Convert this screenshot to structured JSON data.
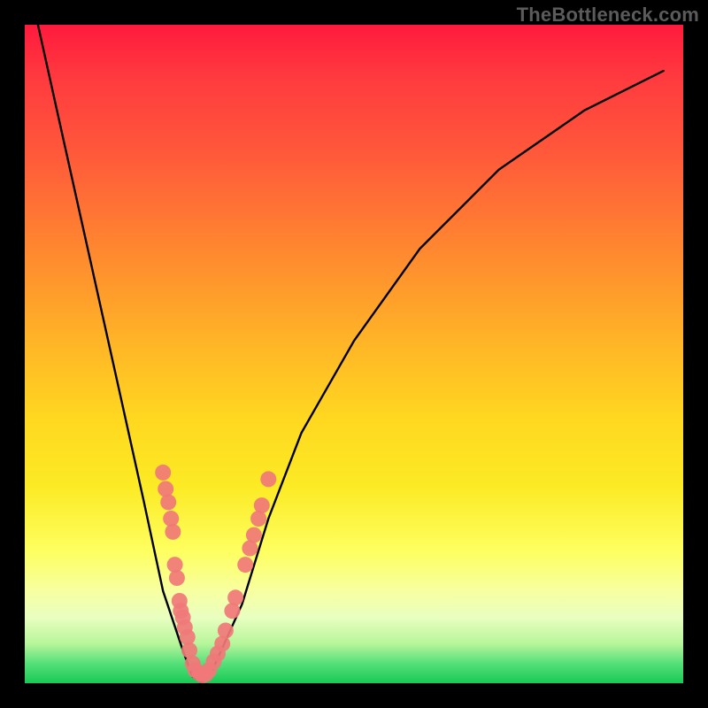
{
  "watermark": "TheBottleneck.com",
  "chart_data": {
    "type": "line",
    "title": "",
    "xlabel": "",
    "ylabel": "",
    "xlim": [
      0,
      100
    ],
    "ylim": [
      0,
      100
    ],
    "grid": false,
    "legend": false,
    "series": [
      {
        "name": "curve",
        "x": [
          2,
          6,
          10,
          14,
          18,
          21,
          24,
          25.5,
          27,
          28.5,
          33,
          37,
          42,
          50,
          60,
          72,
          85,
          97
        ],
        "values": [
          100,
          82,
          64,
          46,
          28,
          14,
          5,
          1,
          0,
          2,
          12,
          25,
          38,
          52,
          66,
          78,
          87,
          93
        ]
      }
    ],
    "markers": [
      {
        "x": 21.0,
        "y": 32.0
      },
      {
        "x": 21.4,
        "y": 29.5
      },
      {
        "x": 21.8,
        "y": 27.5
      },
      {
        "x": 22.2,
        "y": 25.0
      },
      {
        "x": 22.5,
        "y": 23.0
      },
      {
        "x": 22.8,
        "y": 18.0
      },
      {
        "x": 23.1,
        "y": 16.0
      },
      {
        "x": 23.5,
        "y": 12.5
      },
      {
        "x": 23.7,
        "y": 11.0
      },
      {
        "x": 24.0,
        "y": 10.0
      },
      {
        "x": 24.3,
        "y": 8.5
      },
      {
        "x": 24.7,
        "y": 7.0
      },
      {
        "x": 25.0,
        "y": 5.0
      },
      {
        "x": 25.5,
        "y": 3.0
      },
      {
        "x": 25.9,
        "y": 2.0
      },
      {
        "x": 26.5,
        "y": 1.5
      },
      {
        "x": 27.0,
        "y": 1.2
      },
      {
        "x": 27.5,
        "y": 1.4
      },
      {
        "x": 28.0,
        "y": 2.0
      },
      {
        "x": 28.7,
        "y": 3.3
      },
      {
        "x": 29.3,
        "y": 4.5
      },
      {
        "x": 30.0,
        "y": 6.0
      },
      {
        "x": 30.5,
        "y": 8.0
      },
      {
        "x": 31.5,
        "y": 11.0
      },
      {
        "x": 32.0,
        "y": 13.0
      },
      {
        "x": 33.5,
        "y": 18.0
      },
      {
        "x": 34.2,
        "y": 20.5
      },
      {
        "x": 34.8,
        "y": 22.5
      },
      {
        "x": 35.5,
        "y": 25.0
      },
      {
        "x": 36.0,
        "y": 27.0
      },
      {
        "x": 37.0,
        "y": 31.0
      }
    ],
    "marker_color": "#f07878",
    "curve_color": "#000000"
  }
}
